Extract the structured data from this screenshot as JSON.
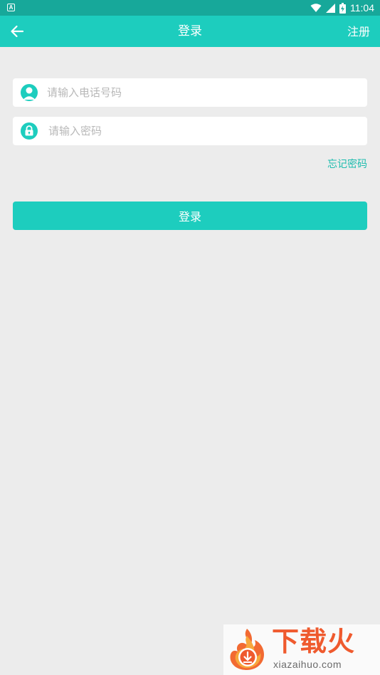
{
  "status_bar": {
    "app_icon_letter": "A",
    "time": "11:04",
    "icons": [
      "wifi-icon",
      "signal-icon",
      "battery-icon"
    ]
  },
  "app_bar": {
    "title": "登录",
    "back_icon": "arrow-left-icon",
    "register_label": "注册"
  },
  "form": {
    "phone": {
      "placeholder": "请输入电话号码",
      "value": "",
      "icon": "user-icon"
    },
    "password": {
      "placeholder": "请输入密码",
      "value": "",
      "icon": "lock-icon"
    },
    "forgot_label": "忘记密码",
    "login_label": "登录"
  },
  "watermark": {
    "logo": "flame-download-icon",
    "title": "下载火",
    "url": "xiazaihuo.com"
  },
  "colors": {
    "status_bar": "#17a89a",
    "accent": "#1dcdbe",
    "background": "#ececec",
    "watermark_title": "#ef5a2e"
  }
}
